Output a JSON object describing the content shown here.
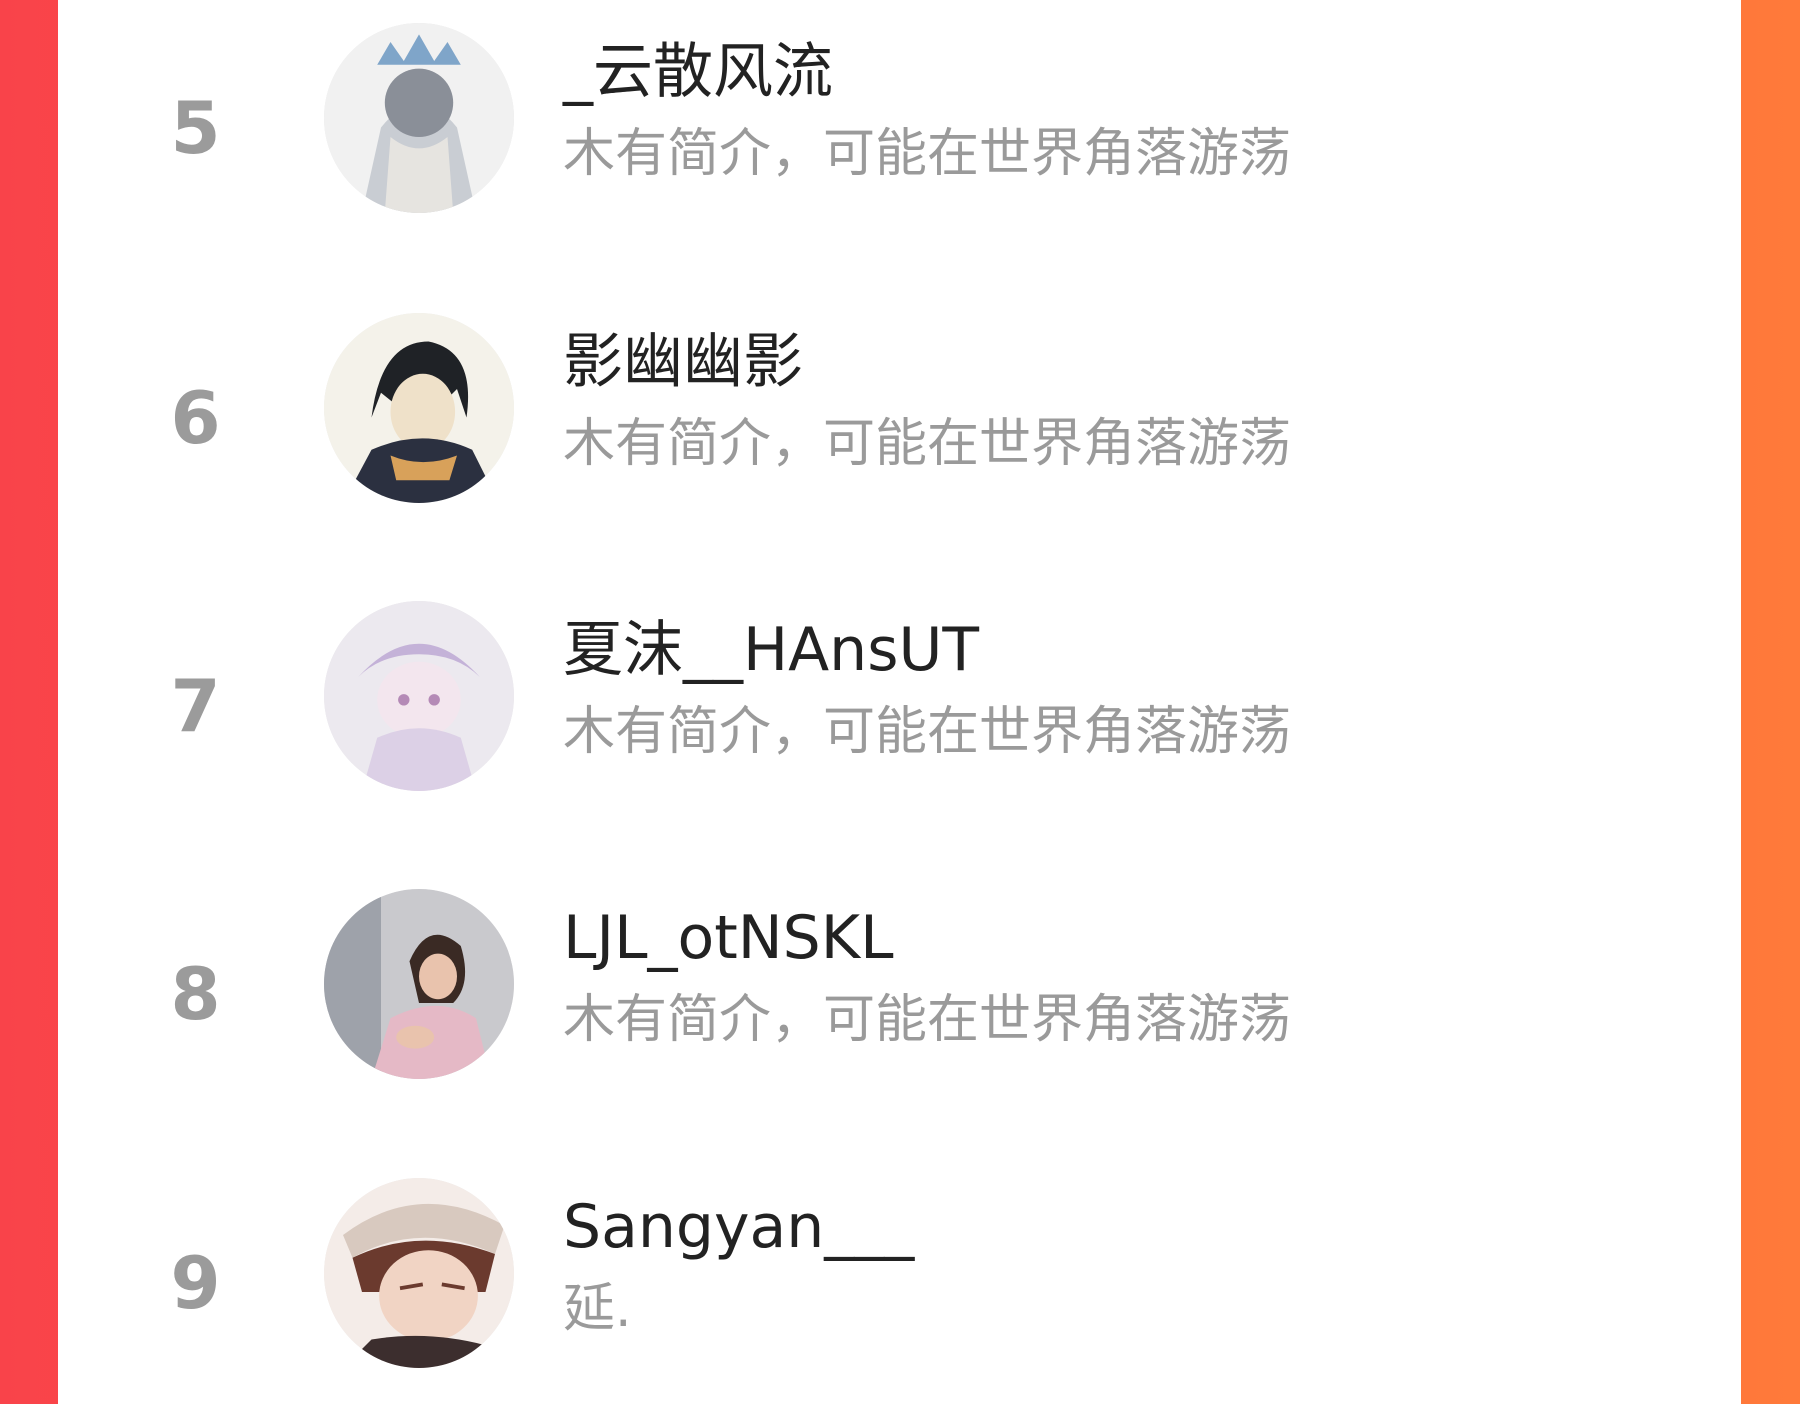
{
  "colors": {
    "background_gradient_start": "#f9434a",
    "background_gradient_end": "#ff7a3a",
    "card": "#ffffff",
    "rank_text": "#9b9b9b",
    "name_text": "#222222",
    "bio_text": "#9a9a9a"
  },
  "ranking": {
    "items": [
      {
        "rank": "5",
        "name": "_云散风流",
        "bio": "木有简介，可能在世界角落游荡",
        "avatar": "anime-avatar-icon"
      },
      {
        "rank": "6",
        "name": "影幽幽影",
        "bio": "木有简介，可能在世界角落游荡",
        "avatar": "anime-avatar-icon"
      },
      {
        "rank": "7",
        "name": "夏沫__HAnsUT",
        "bio": "木有简介，可能在世界角落游荡",
        "avatar": "anime-avatar-icon"
      },
      {
        "rank": "8",
        "name": "LJL_otNSKL",
        "bio": "木有简介，可能在世界角落游荡",
        "avatar": "photo-avatar-icon"
      },
      {
        "rank": "9",
        "name": "Sangyan___",
        "bio": "延.",
        "avatar": "anime-avatar-icon"
      }
    ]
  }
}
